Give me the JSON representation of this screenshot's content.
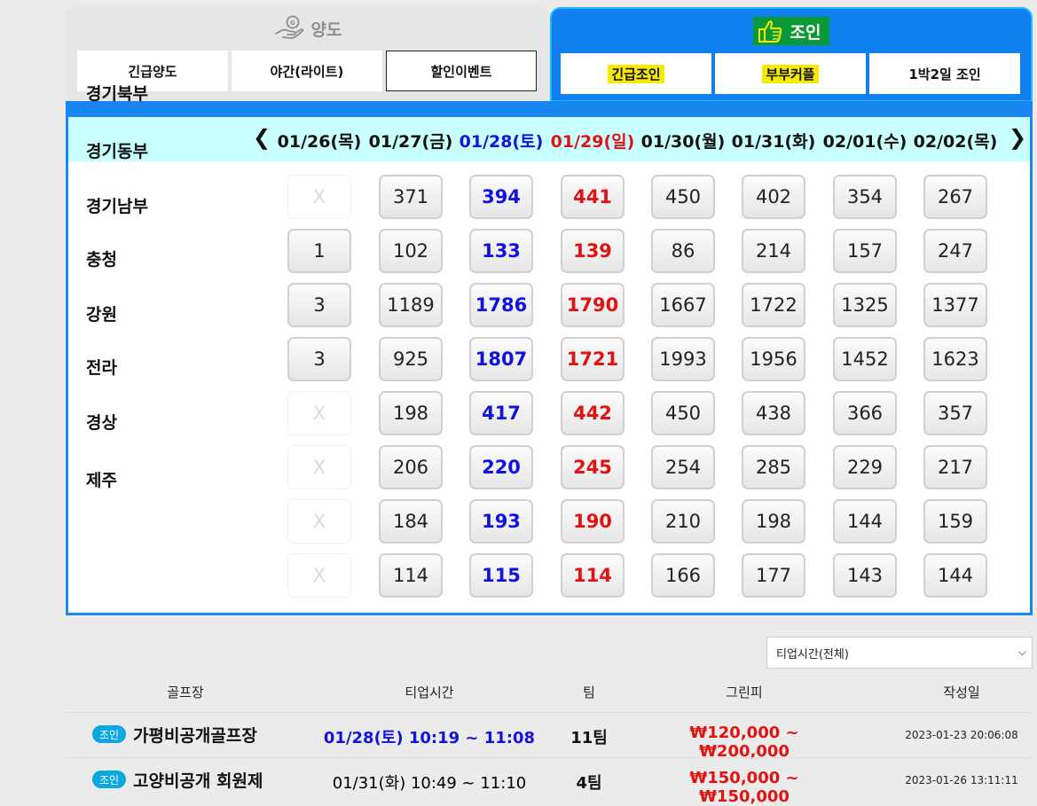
{
  "tabs": {
    "left": {
      "title": "양도",
      "icon": "hand-coin-icon",
      "buttons": [
        "긴급양도",
        "야간(라이트)",
        "할인이벤트"
      ],
      "selected": 2
    },
    "right": {
      "title": "조인",
      "icon": "thumbs-up-hand-icon",
      "buttons": [
        "긴급조인",
        "부부커플",
        "1박2일 조인"
      ]
    }
  },
  "calendar": {
    "dates": [
      {
        "label": "01/26(목)",
        "kind": "weekday"
      },
      {
        "label": "01/27(금)",
        "kind": "weekday"
      },
      {
        "label": "01/28(토)",
        "kind": "sat"
      },
      {
        "label": "01/29(일)",
        "kind": "sun"
      },
      {
        "label": "01/30(월)",
        "kind": "weekday"
      },
      {
        "label": "01/31(화)",
        "kind": "weekday"
      },
      {
        "label": "02/01(수)",
        "kind": "weekday"
      },
      {
        "label": "02/02(목)",
        "kind": "weekday"
      }
    ],
    "prev_icon": "chevron-left-icon",
    "next_icon": "chevron-right-icon",
    "rows": [
      {
        "region": "경기북부",
        "counts": [
          "X",
          "371",
          "394",
          "441",
          "450",
          "402",
          "354",
          "267"
        ]
      },
      {
        "region": "경기동부",
        "counts": [
          "1",
          "102",
          "133",
          "139",
          "86",
          "214",
          "157",
          "247"
        ]
      },
      {
        "region": "경기남부",
        "counts": [
          "3",
          "1189",
          "1786",
          "1790",
          "1667",
          "1722",
          "1325",
          "1377"
        ]
      },
      {
        "region": "충청",
        "counts": [
          "3",
          "925",
          "1807",
          "1721",
          "1993",
          "1956",
          "1452",
          "1623"
        ]
      },
      {
        "region": "강원",
        "counts": [
          "X",
          "198",
          "417",
          "442",
          "450",
          "438",
          "366",
          "357"
        ]
      },
      {
        "region": "전라",
        "counts": [
          "X",
          "206",
          "220",
          "245",
          "254",
          "285",
          "229",
          "217"
        ]
      },
      {
        "region": "경상",
        "counts": [
          "X",
          "184",
          "193",
          "190",
          "210",
          "198",
          "144",
          "159"
        ]
      },
      {
        "region": "제주",
        "counts": [
          "X",
          "114",
          "115",
          "114",
          "166",
          "177",
          "143",
          "144"
        ]
      }
    ]
  },
  "filter": {
    "selected": "티업시간(전체)"
  },
  "list": {
    "headers": [
      "골프장",
      "티업시간",
      "팀",
      "그린피",
      "작성일"
    ],
    "rows": [
      {
        "badge": "조인",
        "course": "가평비공개골프장",
        "teeup": "01/28(토) 10:19 ~ 11:08",
        "teeup_kind": "sat",
        "teams": "11팀",
        "fee": "₩120,000 ~ ₩200,000",
        "written": "2023-01-23 20:06:08"
      },
      {
        "badge": "조인",
        "course": "고양비공개 회원제",
        "teeup": "01/31(화) 10:49 ~ 11:10",
        "teeup_kind": "weekday",
        "teams": "4팀",
        "fee": "₩150,000 ~ ₩150,000",
        "written": "2023-01-26 13:11:11"
      }
    ]
  },
  "colors": {
    "accent_blue": "#1a86ef",
    "saturday": "#1212e0",
    "sunday": "#e01212",
    "badge": "#0aa8dc",
    "highlight": "#f5ea00",
    "title_bg": "#0c9a38"
  }
}
